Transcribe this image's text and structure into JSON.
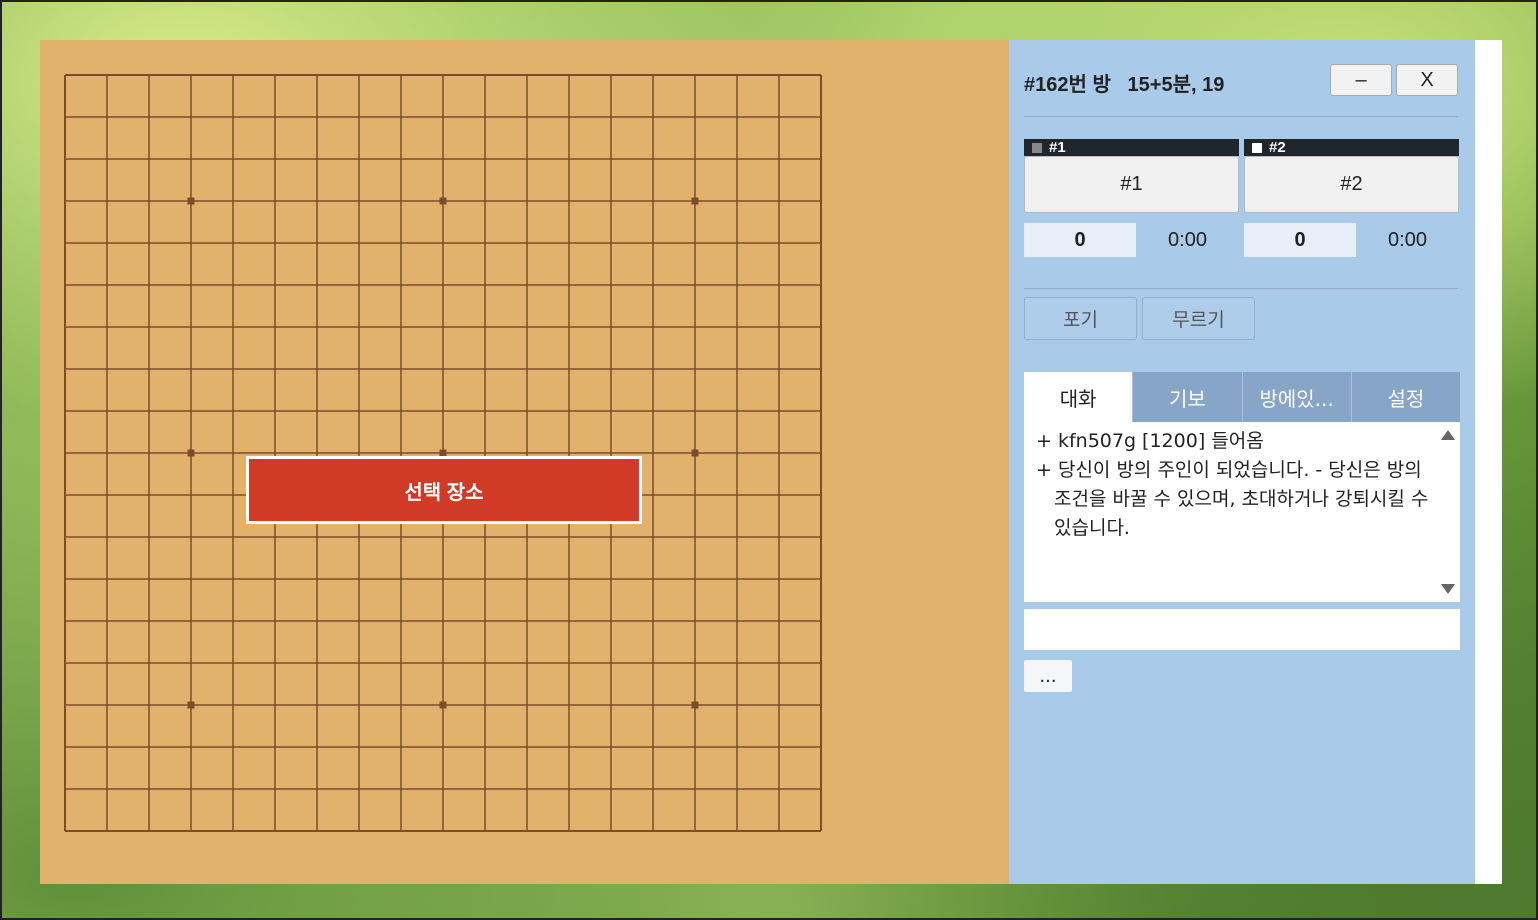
{
  "board": {
    "size": 19,
    "line_color": "#7a4e2b",
    "background_color": "#e2b16c",
    "star_points": [
      [
        3,
        3
      ],
      [
        3,
        9
      ],
      [
        3,
        15
      ],
      [
        9,
        3
      ],
      [
        9,
        9
      ],
      [
        9,
        15
      ],
      [
        15,
        3
      ],
      [
        15,
        9
      ],
      [
        15,
        15
      ]
    ],
    "overlay_label": "선택 장소",
    "overlay_color": "#d13a27"
  },
  "header": {
    "room_title": "#162번 방   15+5분, 19",
    "minimize_label": "–",
    "close_label": "X"
  },
  "players": [
    {
      "header_label": "#1",
      "stone_color": "#888888",
      "name": "#1",
      "captures": "0",
      "time": "0:00"
    },
    {
      "header_label": "#2",
      "stone_color": "#ffffff",
      "name": "#2",
      "captures": "0",
      "time": "0:00"
    }
  ],
  "actions": {
    "resign_label": "포기",
    "undo_label": "무르기"
  },
  "tabs": [
    {
      "label": "대화",
      "active": true
    },
    {
      "label": "기보",
      "active": false
    },
    {
      "label": "방에있...",
      "active": false
    },
    {
      "label": "설정",
      "active": false
    }
  ],
  "chat": {
    "messages": [
      "+ kfn507g [1200] 들어옴",
      "+ 당신이 방의 주인이 되었습니다. - 당신은 방의 조건을 바꿀 수 있으며, 초대하거나 강퇴시킬 수 있습니다."
    ],
    "input_value": "",
    "more_label": "..."
  },
  "colors": {
    "panel_background": "#a9cbe9",
    "tab_inactive": "#87a5c6",
    "player_header": "#1f262d"
  }
}
